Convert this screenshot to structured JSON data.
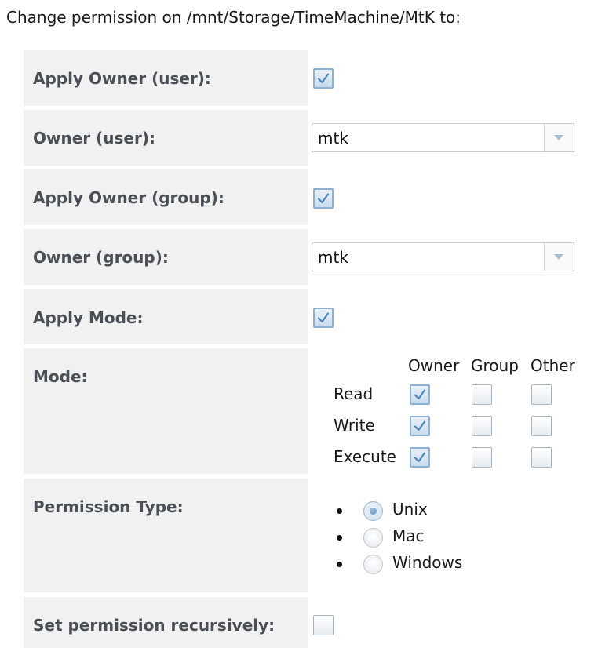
{
  "heading": "Change permission on /mnt/Storage/TimeMachine/MtK to:",
  "fields": {
    "apply_owner_user": {
      "label": "Apply Owner (user):",
      "checked": true
    },
    "owner_user": {
      "label": "Owner (user):",
      "value": "mtk"
    },
    "apply_owner_group": {
      "label": "Apply Owner (group):",
      "checked": true
    },
    "owner_group": {
      "label": "Owner (group):",
      "value": "mtk"
    },
    "apply_mode": {
      "label": "Apply Mode:",
      "checked": true
    },
    "mode": {
      "label": "Mode:",
      "columns": [
        "Owner",
        "Group",
        "Other"
      ],
      "rows": [
        {
          "label": "Read",
          "values": [
            true,
            false,
            false
          ]
        },
        {
          "label": "Write",
          "values": [
            true,
            false,
            false
          ]
        },
        {
          "label": "Execute",
          "values": [
            true,
            false,
            false
          ]
        }
      ]
    },
    "permission_type": {
      "label": "Permission Type:",
      "options": [
        "Unix",
        "Mac",
        "Windows"
      ],
      "selected": "Unix"
    },
    "recursive": {
      "label": "Set permission recursively:",
      "checked": false
    }
  },
  "icons": {
    "checkmark": "checkmark-icon",
    "dropdown": "chevron-down-icon"
  },
  "colors": {
    "label_text": "#4a4f55",
    "label_background": "#f1f1f1",
    "check_accent": "#5a8fc0"
  }
}
